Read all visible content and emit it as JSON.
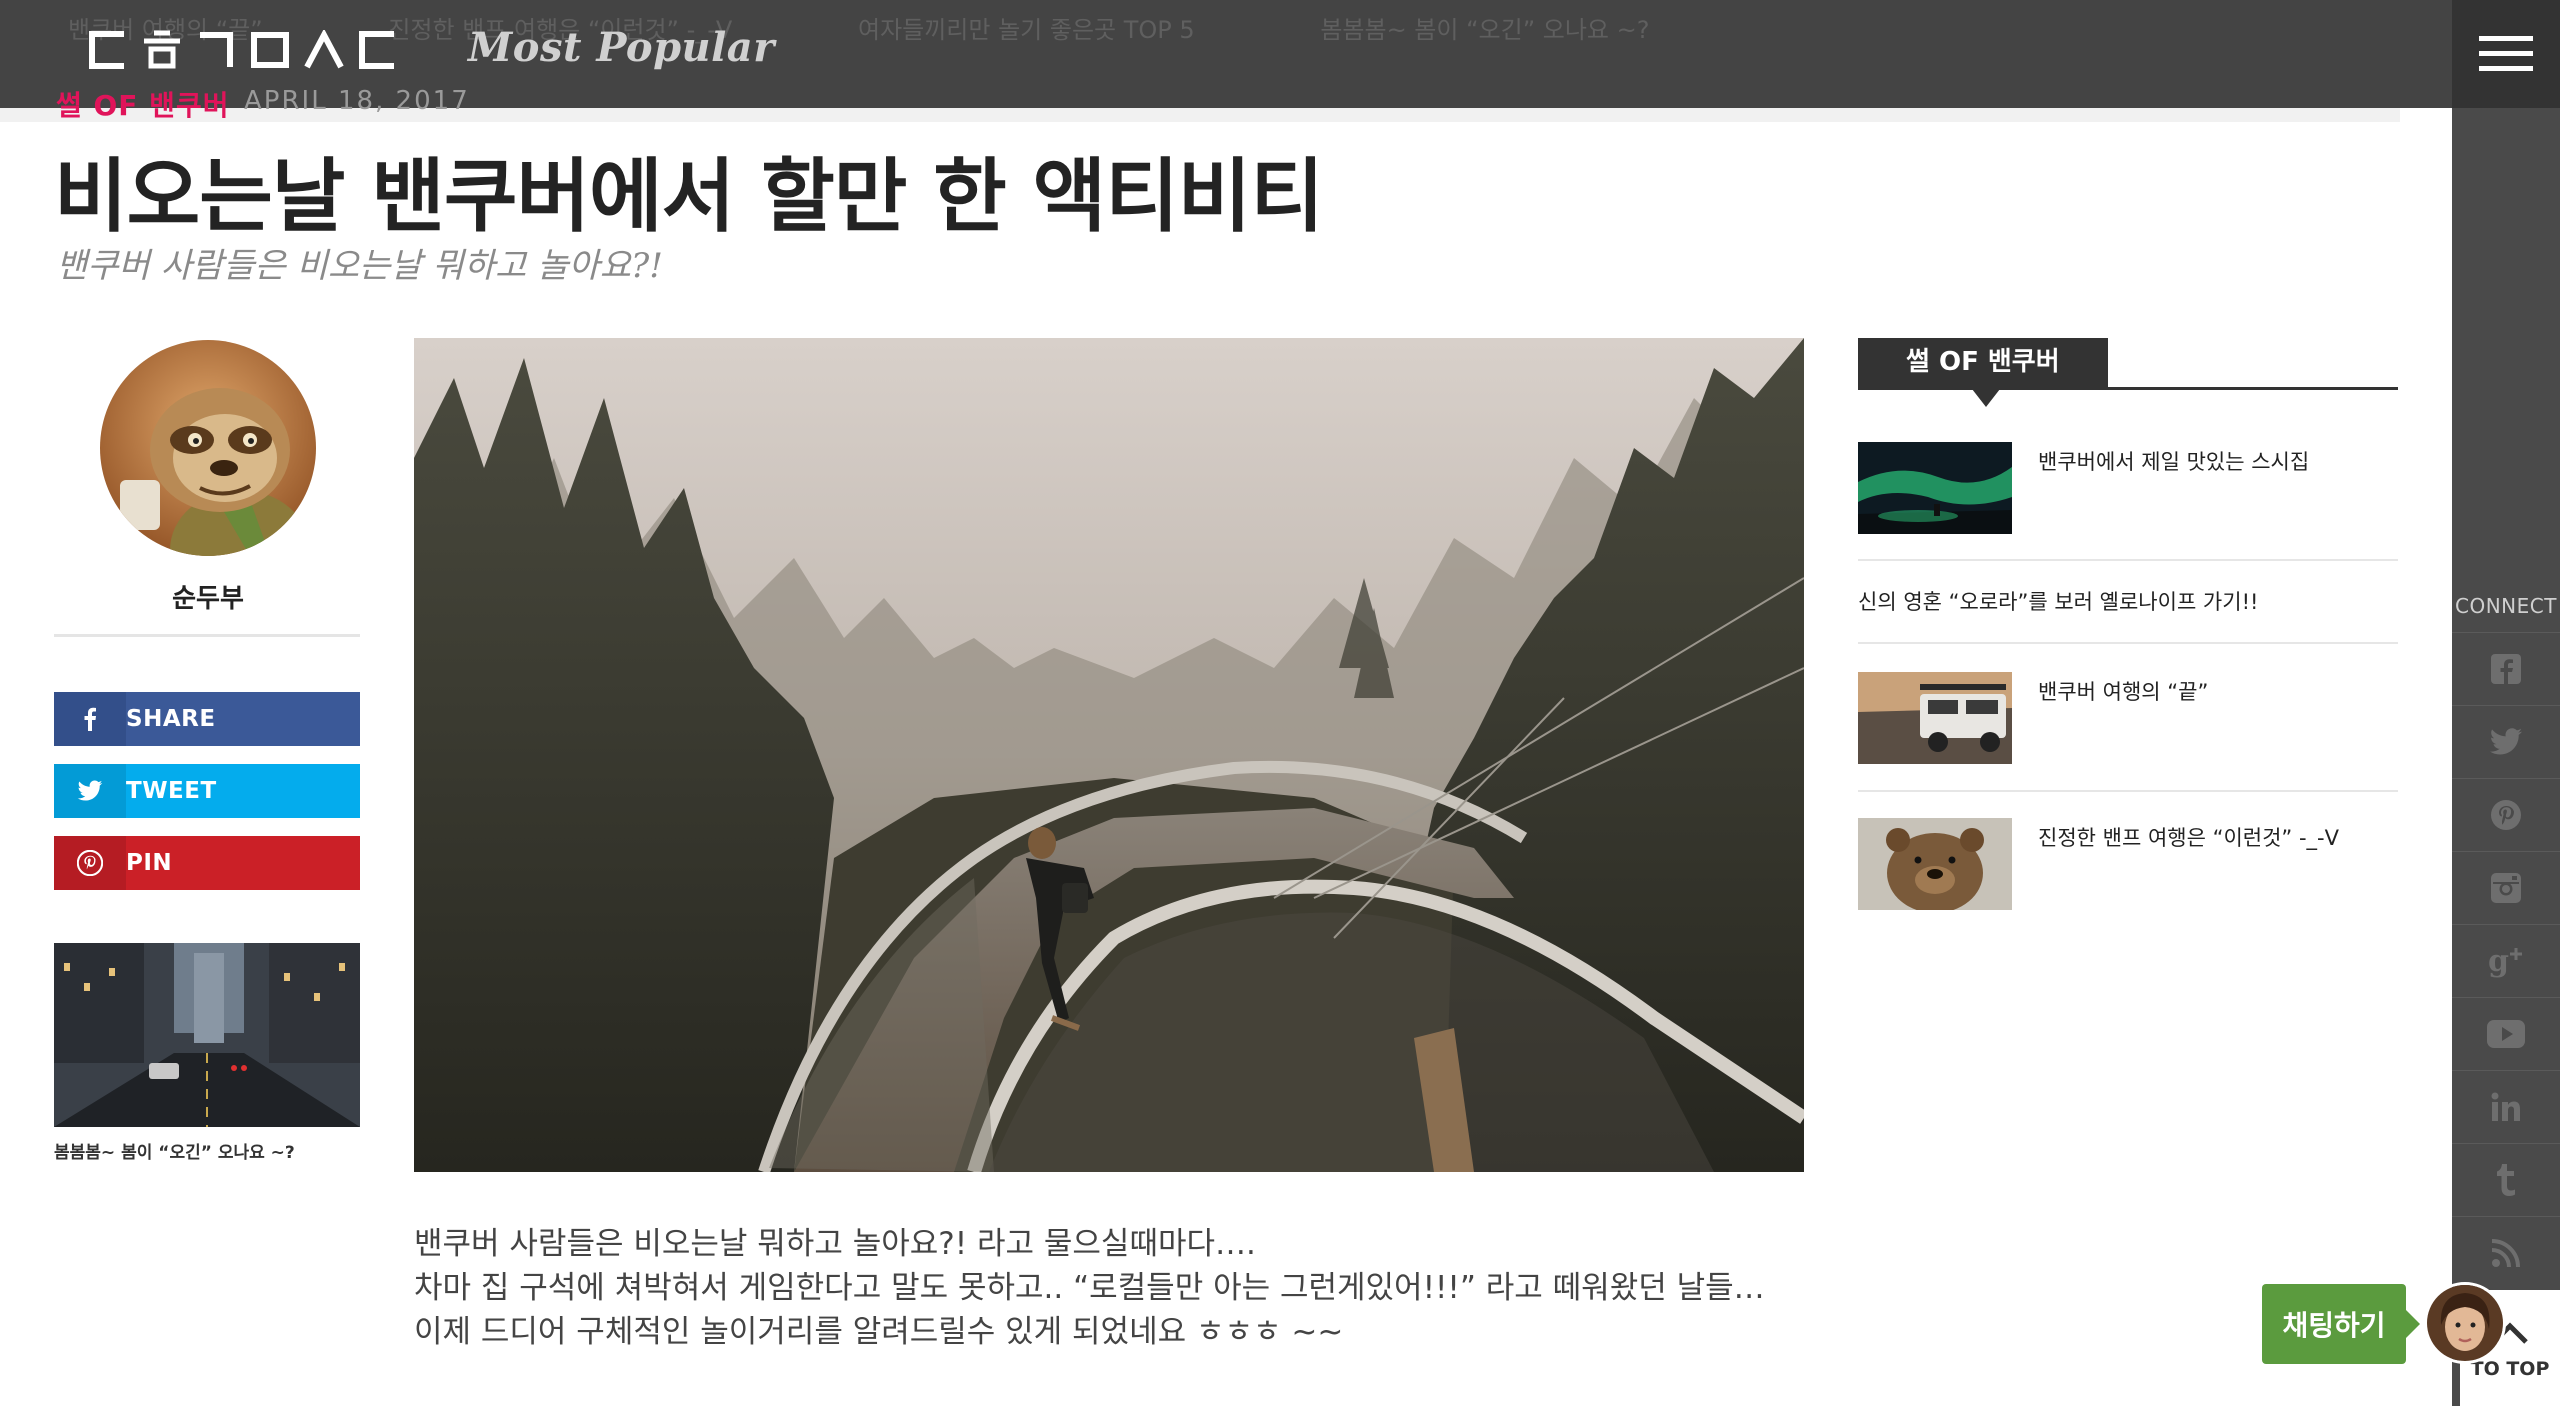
{
  "topbar": {
    "ticker": [
      "밴쿠버 여행의 “끝”",
      "진정한 밴프 여행은 “이런것” -_-V",
      "여자들끼리만 놀기 좋은곳 TOP 5",
      "봄봄봄~ 봄이 “오긴” 오나요 ~?"
    ],
    "logo_alt": "ㄷㅎㄱㅁㅅㄷ",
    "most_popular": "Most Popular"
  },
  "article": {
    "category": "썰 OF 밴쿠버",
    "date": "APRIL 18, 2017",
    "title": "비오는날 밴쿠버에서 할만 한 액티비티",
    "subtitle": "밴쿠버 사람들은 비오는날 뭐하고 놀아요?!",
    "body": [
      "밴쿠버 사람들은 비오는날 뭐하고 놀아요?! 라고 물으실때마다….",
      "차마 집 구석에 쳐박혀서 게임한다고 말도 못하고.. “로컬들만 아는 그런게있어!!!” 라고 떼워왔던 날들…",
      "이제 드디어 구체적인 놀이거리를 알려드릴수 있게 되었네요 ㅎㅎㅎ ~~"
    ]
  },
  "author": {
    "name": "순두부"
  },
  "share": {
    "facebook": "SHARE",
    "twitter": "TWEET",
    "pinterest": "PIN"
  },
  "related": {
    "caption": "봄봄봄~ 봄이 “오긴” 오나요 ~?"
  },
  "widget": {
    "title": "썰 OF 밴쿠버",
    "items": [
      {
        "text": "밴쿠버에서 제일 맛있는 스시집",
        "thumb": "aurora-icon"
      },
      {
        "text": "신의 영혼 “오로라”를 보러 옐로나이프 가기!!"
      },
      {
        "text": "밴쿠버 여행의 “끝”",
        "thumb": "jeep-icon"
      },
      {
        "text": "진정한 밴프 여행은 “이런것” -_-V",
        "thumb": "bear-icon"
      }
    ]
  },
  "rail": {
    "connect": "CONNECT",
    "icons": [
      "facebook-icon",
      "twitter-icon",
      "pinterest-icon",
      "instagram-icon",
      "google-plus-icon",
      "youtube-icon",
      "linkedin-icon",
      "tumblr-icon",
      "rss-icon"
    ]
  },
  "chat": {
    "label": "채팅하기"
  },
  "to_top": {
    "label": "TO TOP"
  },
  "colors": {
    "topbar": "#444444",
    "rail": "#4a4a4a",
    "accent": "#e0145a",
    "chat": "#5b9b3e",
    "facebook": "#3b5998",
    "twitter": "#04aced",
    "pinterest": "#cb2027"
  }
}
